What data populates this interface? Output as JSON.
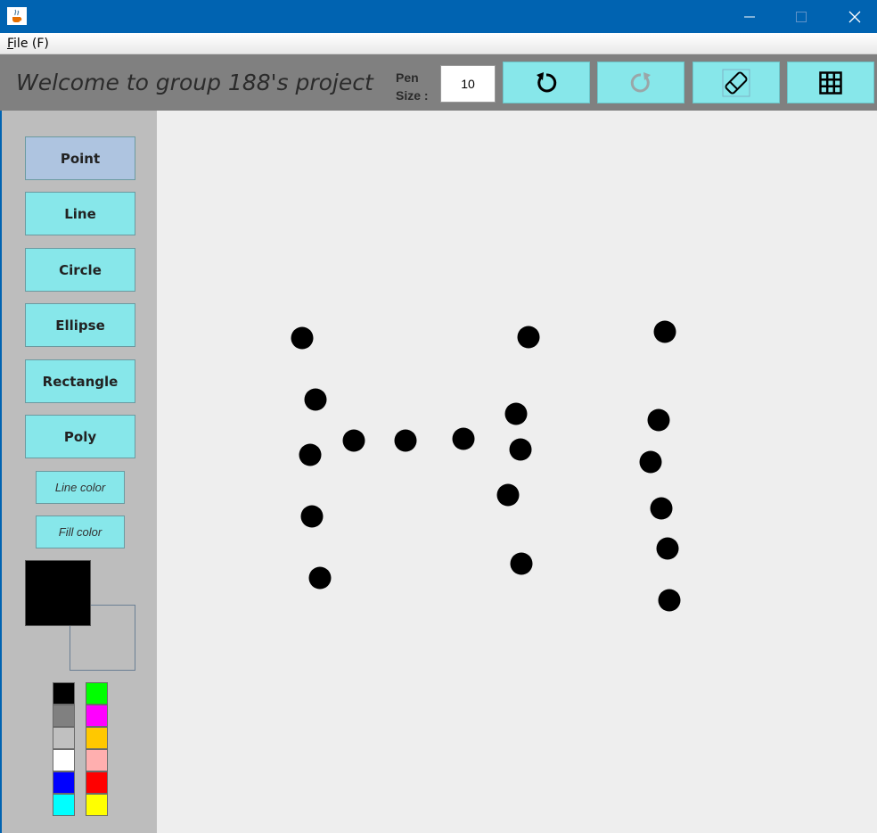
{
  "menu": {
    "file_label": "File (F)"
  },
  "toolbar": {
    "welcome": "Welcome to group 188's project",
    "pen_label_line1": "Pen",
    "pen_label_line2": "Size :",
    "pen_size": "10"
  },
  "sidebar": {
    "tools": [
      {
        "label": "Point",
        "active": true
      },
      {
        "label": "Line"
      },
      {
        "label": "Circle"
      },
      {
        "label": "Ellipse"
      },
      {
        "label": "Rectangle"
      },
      {
        "label": "Poly"
      }
    ],
    "line_color_label": "Line color",
    "fill_color_label": "Fill color",
    "current_line_color": "#000000",
    "palette_left": [
      "#000000",
      "#808080",
      "#c0c0c0",
      "#ffffff",
      "#0000ff",
      "#00ffff"
    ],
    "palette_right": [
      "#00ff00",
      "#ff00ff",
      "#ffc800",
      "#ffafaf",
      "#ff0000",
      "#ffff00"
    ]
  },
  "colors": {
    "accent": "#87e7ea",
    "selected_tool": "#aec4e0",
    "titlebar": "#0063b1",
    "point": "#000000"
  },
  "icons": {
    "app": "java-cup-icon",
    "undo": "undo-icon",
    "redo": "redo-icon",
    "eraser": "eraser-icon",
    "grid": "grid-icon"
  }
}
